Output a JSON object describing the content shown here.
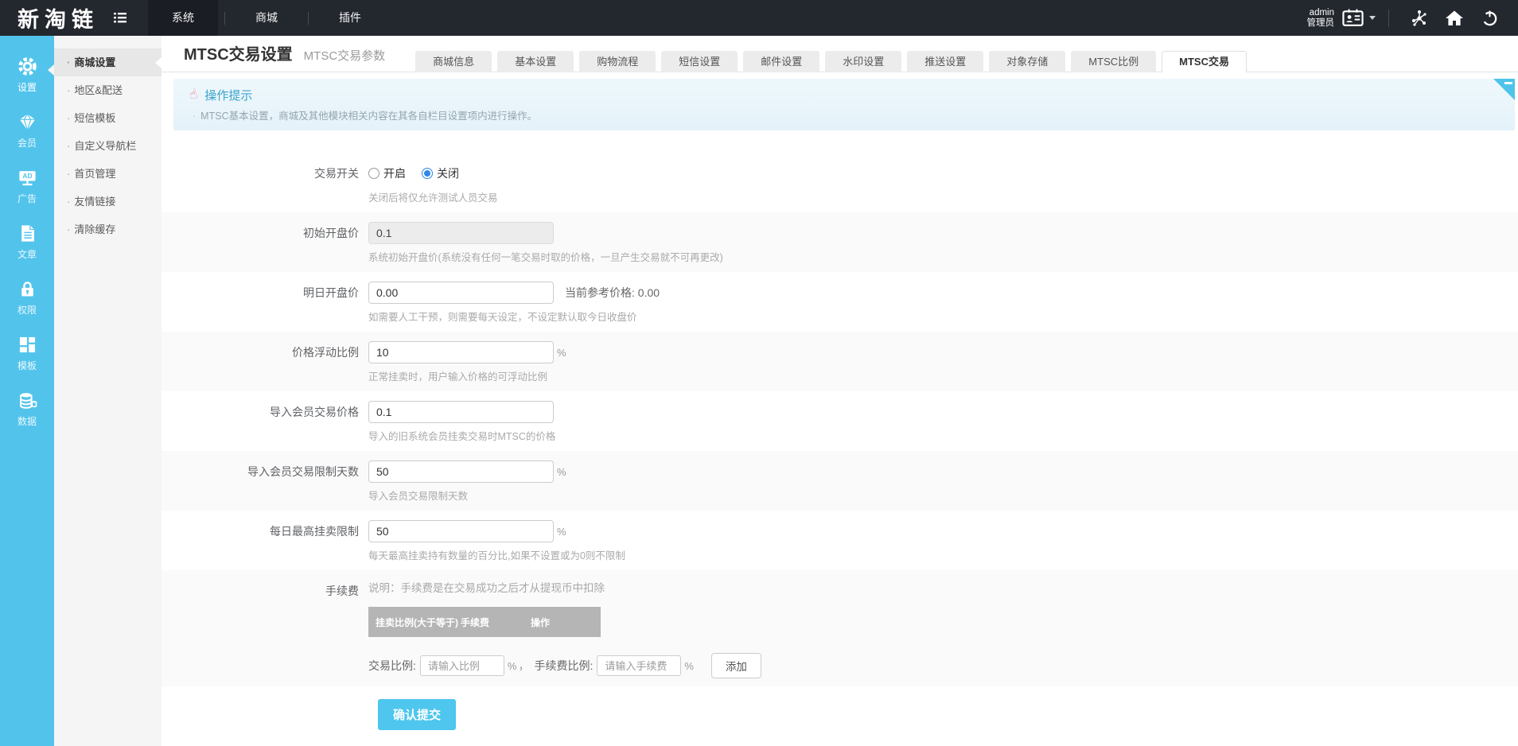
{
  "colors": {
    "topbar_bg": "#23272e",
    "sidebar_blue": "#52c4ec",
    "accent_cyan": "#4ec6ee",
    "notice_title_blue": "#3ba3cf",
    "radio_checked_blue": "#2f87e8",
    "fee_header_gray": "#b5b5b5"
  },
  "topbar": {
    "logo": "新淘链",
    "menu": [
      {
        "label": "系统",
        "active": true
      },
      {
        "label": "商城",
        "active": false
      },
      {
        "label": "插件",
        "active": false
      }
    ],
    "user_name": "admin",
    "user_role": "管理员"
  },
  "iconbar": {
    "items": [
      {
        "label": "设置",
        "icon": "gear-icon",
        "active": true
      },
      {
        "label": "会员",
        "icon": "vip-diamond-icon",
        "active": false
      },
      {
        "label": "广告",
        "icon": "ad-billboard-icon",
        "active": false
      },
      {
        "label": "文章",
        "icon": "article-icon",
        "active": false
      },
      {
        "label": "权限",
        "icon": "lock-icon",
        "active": false
      },
      {
        "label": "模板",
        "icon": "template-grid-icon",
        "active": false
      },
      {
        "label": "数据",
        "icon": "database-icon",
        "active": false
      }
    ]
  },
  "submenu": {
    "bullet": "·",
    "items": [
      {
        "label": "商城设置",
        "active": true
      },
      {
        "label": "地区&配送",
        "active": false
      },
      {
        "label": "短信模板",
        "active": false
      },
      {
        "label": "自定义导航栏",
        "active": false
      },
      {
        "label": "首页管理",
        "active": false
      },
      {
        "label": "友情链接",
        "active": false
      },
      {
        "label": "清除缓存",
        "active": false
      }
    ]
  },
  "header": {
    "title": "MTSC交易设置",
    "subtitle": "MTSC交易参数",
    "tabs": [
      {
        "label": "商城信息",
        "active": false
      },
      {
        "label": "基本设置",
        "active": false
      },
      {
        "label": "购物流程",
        "active": false
      },
      {
        "label": "短信设置",
        "active": false
      },
      {
        "label": "邮件设置",
        "active": false
      },
      {
        "label": "水印设置",
        "active": false
      },
      {
        "label": "推送设置",
        "active": false
      },
      {
        "label": "对象存储",
        "active": false
      },
      {
        "label": "MTSC比例",
        "active": false
      },
      {
        "label": "MTSC交易",
        "active": true
      }
    ]
  },
  "notice": {
    "title": "操作提示",
    "bullet": "·",
    "text": "MTSC基本设置，商城及其他模块相关内容在其各自栏目设置项内进行操作。"
  },
  "form": {
    "trade_switch": {
      "label": "交易开关",
      "option_on": "开启",
      "option_off": "关闭",
      "selected": "关闭",
      "hint": "关闭后将仅允许测试人员交易"
    },
    "initial_price": {
      "label": "初始开盘价",
      "value": "0.1",
      "hint": "系统初始开盘价(系统没有任何一笔交易时取的价格，一旦产生交易就不可再更改)"
    },
    "tomorrow_price": {
      "label": "明日开盘价",
      "value": "0.00",
      "reference": "当前参考价格: 0.00",
      "hint": "如需要人工干预，则需要每天设定，不设定默认取今日收盘价"
    },
    "float_ratio": {
      "label": "价格浮动比例",
      "value": "10",
      "suffix": "%",
      "hint": "正常挂卖时，用户输入价格的可浮动比例"
    },
    "import_price": {
      "label": "导入会员交易价格",
      "value": "0.1",
      "hint": "导入的旧系统会员挂卖交易时MTSC的价格"
    },
    "import_limit_days": {
      "label": "导入会员交易限制天数",
      "value": "50",
      "suffix": "%",
      "hint": "导入会员交易限制天数"
    },
    "daily_max_limit": {
      "label": "每日最高挂卖限制",
      "value": "50",
      "suffix": "%",
      "hint": "每天最高挂卖持有数量的百分比,如果不设置或为0则不限制"
    },
    "fee": {
      "label": "手续费",
      "note": "说明：手续费是在交易成功之后才从提现币中扣除",
      "table_headers": [
        "挂卖比例(大于等于)",
        "手续费",
        "操作"
      ],
      "ratio_label": "交易比例:",
      "ratio_placeholder": "请输入比例",
      "percent": "%",
      "comma": "，",
      "fee_label": "手续费比例:",
      "fee_placeholder": "请输入手续费",
      "add_button": "添加"
    },
    "submit_button": "确认提交"
  }
}
